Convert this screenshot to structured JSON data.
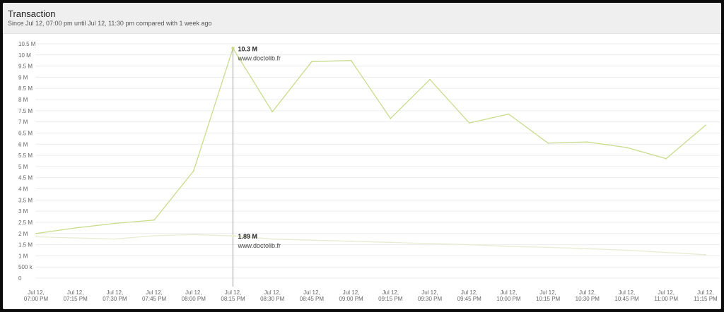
{
  "header": {
    "title": "Transaction",
    "subtitle": "Since Jul 12, 07:00 pm until Jul 12, 11:30 pm compared with 1 week ago"
  },
  "colors": {
    "current": "#c8dc8c",
    "previous": "#e6ecd0",
    "crosshair": "#9a9a9a",
    "grid": "#ececec"
  },
  "chart_data": {
    "type": "line",
    "title": "Transaction",
    "ylim": [
      0,
      10.5
    ],
    "y_ticks": [
      "0",
      "500 k",
      "1 M",
      "1.5 M",
      "2 M",
      "2.5 M",
      "3 M",
      "3.5 M",
      "4 M",
      "4.5 M",
      "5 M",
      "5.5 M",
      "6 M",
      "6.5 M",
      "7 M",
      "7.5 M",
      "8 M",
      "8.5 M",
      "9 M",
      "9.5 M",
      "10 M",
      "10.5 M"
    ],
    "x_ticks": [
      [
        "Jul 12,",
        "07:00 PM"
      ],
      [
        "Jul 12,",
        "07:15 PM"
      ],
      [
        "Jul 12,",
        "07:30 PM"
      ],
      [
        "Jul 12,",
        "07:45 PM"
      ],
      [
        "Jul 12,",
        "08:00 PM"
      ],
      [
        "Jul 12,",
        "08:15 PM"
      ],
      [
        "Jul 12,",
        "08:30 PM"
      ],
      [
        "Jul 12,",
        "08:45 PM"
      ],
      [
        "Jul 12,",
        "09:00 PM"
      ],
      [
        "Jul 12,",
        "09:15 PM"
      ],
      [
        "Jul 12,",
        "09:30 PM"
      ],
      [
        "Jul 12,",
        "09:45 PM"
      ],
      [
        "Jul 12,",
        "10:00 PM"
      ],
      [
        "Jul 12,",
        "10:15 PM"
      ],
      [
        "Jul 12,",
        "10:30 PM"
      ],
      [
        "Jul 12,",
        "10:45 PM"
      ],
      [
        "Jul 12,",
        "11:00 PM"
      ],
      [
        "Jul 12,",
        "11:15 PM"
      ]
    ],
    "series": [
      {
        "name": "www.doctolib.fr",
        "role": "current",
        "points": [
          [
            0,
            2.0
          ],
          [
            1,
            2.25
          ],
          [
            2,
            2.45
          ],
          [
            3,
            2.6
          ],
          [
            4,
            4.8
          ],
          [
            5,
            10.3
          ],
          [
            6,
            7.45
          ],
          [
            7,
            9.7
          ],
          [
            8,
            9.75
          ],
          [
            9,
            7.15
          ],
          [
            10,
            8.9
          ],
          [
            11,
            6.95
          ],
          [
            12,
            7.35
          ],
          [
            13,
            6.05
          ],
          [
            14,
            6.1
          ],
          [
            15,
            5.85
          ],
          [
            16,
            5.35
          ],
          [
            17,
            6.85
          ]
        ]
      },
      {
        "name": "www.doctolib.fr",
        "role": "previous",
        "points": [
          [
            0,
            1.85
          ],
          [
            1,
            1.8
          ],
          [
            2,
            1.75
          ],
          [
            3,
            1.9
          ],
          [
            4,
            1.95
          ],
          [
            5,
            1.89
          ],
          [
            6,
            1.75
          ],
          [
            7,
            1.7
          ],
          [
            8,
            1.65
          ],
          [
            9,
            1.6
          ],
          [
            10,
            1.55
          ],
          [
            11,
            1.5
          ],
          [
            12,
            1.42
          ],
          [
            13,
            1.38
          ],
          [
            14,
            1.32
          ],
          [
            15,
            1.25
          ],
          [
            16,
            1.15
          ],
          [
            17,
            1.05
          ]
        ]
      }
    ],
    "hover": {
      "index": 5,
      "current_value": "10.3 M",
      "current_name": "www.doctolib.fr",
      "previous_value": "1.89 M",
      "previous_name": "www.doctolib.fr"
    }
  }
}
